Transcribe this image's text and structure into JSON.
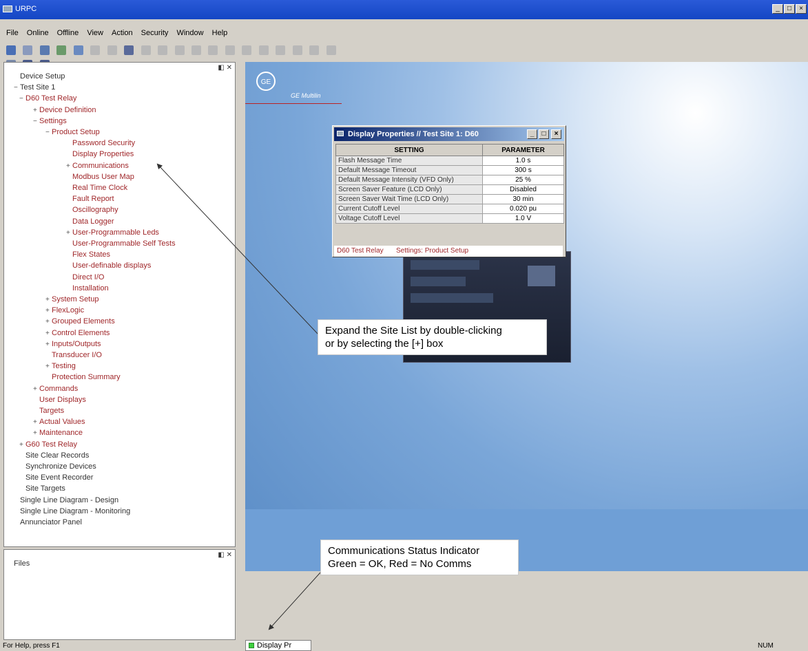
{
  "window": {
    "title": "URPC"
  },
  "menu": [
    "File",
    "Online",
    "Offline",
    "View",
    "Action",
    "Security",
    "Window",
    "Help"
  ],
  "tree": [
    {
      "label": "Device Setup",
      "color": "dark",
      "level": 0,
      "exp": ""
    },
    {
      "label": "Test Site 1",
      "color": "dark",
      "level": 0,
      "exp": "−"
    },
    {
      "label": "D60 Test Relay",
      "color": "red",
      "level": 1,
      "exp": "−"
    },
    {
      "label": "Device Definition",
      "color": "red",
      "level": 2,
      "exp": "+"
    },
    {
      "label": "Settings",
      "color": "red",
      "level": 2,
      "exp": "−"
    },
    {
      "label": "Product Setup",
      "color": "red",
      "level": 3,
      "exp": "−"
    },
    {
      "label": "Password Security",
      "color": "red",
      "level": 4,
      "exp": ""
    },
    {
      "label": "Display Properties",
      "color": "red",
      "level": 4,
      "exp": ""
    },
    {
      "label": "Communications",
      "color": "red",
      "level": 4,
      "exp": "+"
    },
    {
      "label": "Modbus User Map",
      "color": "red",
      "level": 4,
      "exp": ""
    },
    {
      "label": "Real Time Clock",
      "color": "red",
      "level": 4,
      "exp": ""
    },
    {
      "label": "Fault Report",
      "color": "red",
      "level": 4,
      "exp": ""
    },
    {
      "label": "Oscillography",
      "color": "red",
      "level": 4,
      "exp": ""
    },
    {
      "label": "Data Logger",
      "color": "red",
      "level": 4,
      "exp": ""
    },
    {
      "label": "User-Programmable Leds",
      "color": "red",
      "level": 4,
      "exp": "+"
    },
    {
      "label": "User-Programmable Self Tests",
      "color": "red",
      "level": 4,
      "exp": ""
    },
    {
      "label": "Flex States",
      "color": "red",
      "level": 4,
      "exp": ""
    },
    {
      "label": "User-definable displays",
      "color": "red",
      "level": 4,
      "exp": ""
    },
    {
      "label": "Direct I/O",
      "color": "red",
      "level": 4,
      "exp": ""
    },
    {
      "label": "Installation",
      "color": "red",
      "level": 4,
      "exp": ""
    },
    {
      "label": "System Setup",
      "color": "red",
      "level": 3,
      "exp": "+"
    },
    {
      "label": "FlexLogic",
      "color": "red",
      "level": 3,
      "exp": "+"
    },
    {
      "label": "Grouped Elements",
      "color": "red",
      "level": 3,
      "exp": "+"
    },
    {
      "label": "Control Elements",
      "color": "red",
      "level": 3,
      "exp": "+"
    },
    {
      "label": "Inputs/Outputs",
      "color": "red",
      "level": 3,
      "exp": "+"
    },
    {
      "label": "Transducer I/O",
      "color": "red",
      "level": 3,
      "exp": ""
    },
    {
      "label": "Testing",
      "color": "red",
      "level": 3,
      "exp": "+"
    },
    {
      "label": "Protection Summary",
      "color": "red",
      "level": 3,
      "exp": ""
    },
    {
      "label": "Commands",
      "color": "red",
      "level": 2,
      "exp": "+"
    },
    {
      "label": "User Displays",
      "color": "red",
      "level": 2,
      "exp": ""
    },
    {
      "label": "Targets",
      "color": "red",
      "level": 2,
      "exp": ""
    },
    {
      "label": "Actual Values",
      "color": "red",
      "level": 2,
      "exp": "+"
    },
    {
      "label": "Maintenance",
      "color": "red",
      "level": 2,
      "exp": "+"
    },
    {
      "label": "G60 Test Relay",
      "color": "red",
      "level": 1,
      "exp": "+"
    },
    {
      "label": "Site Clear Records",
      "color": "dark",
      "level": 1,
      "exp": ""
    },
    {
      "label": "Synchronize Devices",
      "color": "dark",
      "level": 1,
      "exp": ""
    },
    {
      "label": "Site Event Recorder",
      "color": "dark",
      "level": 1,
      "exp": ""
    },
    {
      "label": "Site Targets",
      "color": "dark",
      "level": 1,
      "exp": ""
    },
    {
      "label": "Single Line Diagram - Design",
      "color": "dark",
      "level": 0,
      "exp": ""
    },
    {
      "label": "Single Line Diagram - Monitoring",
      "color": "dark",
      "level": 0,
      "exp": ""
    },
    {
      "label": "Annunciator Panel",
      "color": "dark",
      "level": 0,
      "exp": ""
    }
  ],
  "files": {
    "label": "Files"
  },
  "logo": {
    "text": "GE",
    "subtitle": "GE Multilin"
  },
  "dialog": {
    "title": "Display Properties // Test Site 1: D60",
    "headers": [
      "SETTING",
      "PARAMETER"
    ],
    "rows": [
      [
        "Flash Message Time",
        "1.0 s"
      ],
      [
        "Default Message Timeout",
        "300 s"
      ],
      [
        "Default Message Intensity (VFD Only)",
        "25 %"
      ],
      [
        "Screen Saver Feature (LCD Only)",
        "Disabled"
      ],
      [
        "Screen Saver Wait Time (LCD Only)",
        "30 min"
      ],
      [
        "Current Cutoff Level",
        "0.020 pu"
      ],
      [
        "Voltage Cutoff Level",
        "1.0 V"
      ]
    ],
    "status_device": "D60 Test Relay",
    "status_path": "Settings: Product Setup"
  },
  "callouts": {
    "expand": [
      "Expand the Site List by double-clicking",
      "or by selecting the [+] box"
    ],
    "comms": [
      "Communications Status Indicator",
      "Green = OK, Red = No Comms"
    ]
  },
  "tab": {
    "label": "Display Pr"
  },
  "status": {
    "help": "For Help, press F1",
    "num": "NUM"
  },
  "colors": {
    "title_bar": "#1446c4",
    "tree_red": "#a0272a",
    "comms_ok": "#3fcf3f"
  }
}
